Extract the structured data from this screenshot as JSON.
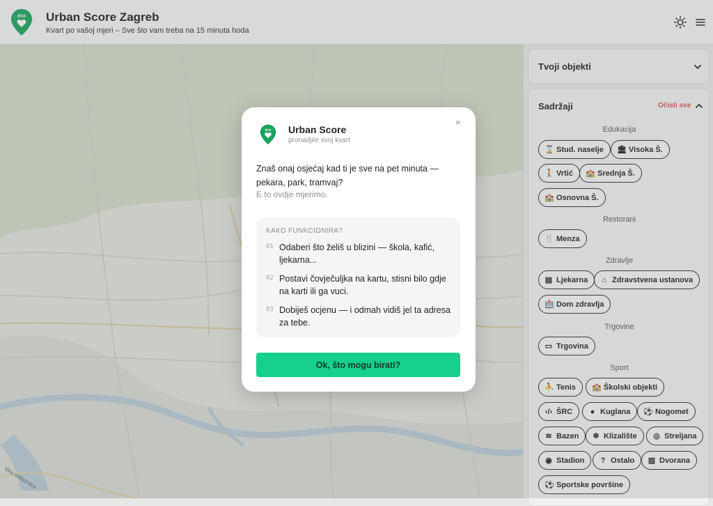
{
  "header": {
    "title": "Urban Score Zagreb",
    "subtitle": "Kvart po vašoj mjeri – Sve što vam treba na 15 minuta hoda",
    "logo_text": "9/10"
  },
  "map": {
    "street_label": "ička obilaznica"
  },
  "panel": {
    "my_objects": {
      "title": "Tvoji objekti"
    },
    "amenities": {
      "title": "Sadržaji",
      "clear_label": "Očisti sve",
      "categories": [
        {
          "label": "Edukacija",
          "chips": [
            {
              "icon": "hourglass-icon",
              "label": "Stud. naselje"
            },
            {
              "icon": "bank-icon",
              "label": "Visoka Š."
            },
            {
              "icon": "child-icon",
              "label": "Vrtić"
            },
            {
              "icon": "school-icon",
              "label": "Srednja Š."
            },
            {
              "icon": "school-icon",
              "label": "Osnovna Š."
            }
          ]
        },
        {
          "label": "Restorani",
          "chips": [
            {
              "icon": "utensils-icon",
              "label": "Menza"
            }
          ]
        },
        {
          "label": "Zdravlje",
          "chips": [
            {
              "icon": "pill-bottle-icon",
              "label": "Ljekarna"
            },
            {
              "icon": "clinic-icon",
              "label": "Zdravstvena ustanova"
            },
            {
              "icon": "hospital-icon",
              "label": "Dom zdravlja"
            }
          ]
        },
        {
          "label": "Trgovine",
          "chips": [
            {
              "icon": "store-icon",
              "label": "Trgovina"
            }
          ]
        },
        {
          "label": "Sport",
          "chips": [
            {
              "icon": "tennis-icon",
              "label": "Tenis"
            },
            {
              "icon": "school-icon",
              "label": "Školski objekti"
            },
            {
              "icon": "code-icon",
              "label": "ŠRC"
            },
            {
              "icon": "bowling-icon",
              "label": "Kuglana"
            },
            {
              "icon": "football-icon",
              "label": "Nogomet"
            },
            {
              "icon": "water-icon",
              "label": "Bazen"
            },
            {
              "icon": "snowflake-icon",
              "label": "Klizalište"
            },
            {
              "icon": "target-icon",
              "label": "Streljana"
            },
            {
              "icon": "stadium-icon",
              "label": "Stadion"
            },
            {
              "icon": "question-icon",
              "label": "Ostalo"
            },
            {
              "icon": "building-icon",
              "label": "Dvorana"
            },
            {
              "icon": "ball-icon",
              "label": "Sportske površine"
            }
          ]
        }
      ]
    }
  },
  "modal": {
    "logo_text": "9/10",
    "title": "Urban Score",
    "subtitle": "pronadjite svoj kvart",
    "close_label": "×",
    "intro": "Znaš onaj osjećaj kad ti je sve na pet minuta — pekara, park, tramvaj?",
    "intro_muted": "E to ovdje mjerimo.",
    "how_heading": "KAKO FUNKCIONIRA?",
    "steps": [
      {
        "num": "01",
        "text": "Odaberi što želiš u blizini — škola, kafić, ljekarna..."
      },
      {
        "num": "02",
        "text": "Postavi čovječuljka na kartu, stisni bilo gdje na karti ili ga vuci."
      },
      {
        "num": "03",
        "text": "Dobiješ ocjenu — i odmah vidiš jel ta adresa za tebe."
      }
    ],
    "cta_label": "Ok, što mogu birati?"
  },
  "colors": {
    "accent": "#17d08b",
    "logo_green": "#1aa35c",
    "danger": "#d9534f"
  }
}
